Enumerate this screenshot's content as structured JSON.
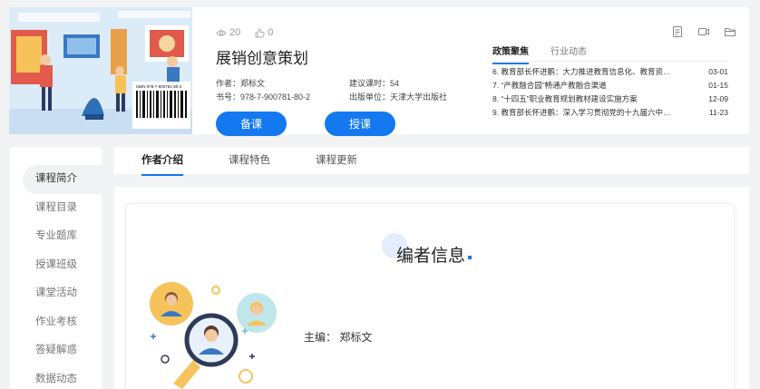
{
  "book": {
    "views": "20",
    "likes": "0",
    "title": "展销创意策划",
    "author": "作者：郑标文",
    "hours": "建议课时：54",
    "isbn": "书号：978-7-900781-80-2",
    "publisher": "出版单位：天津大学出版社",
    "btn_prepare": "备课",
    "btn_teach": "授课",
    "barcode_text": "ISBN 978-7-900781-80-2"
  },
  "news": {
    "tabs": [
      "政策聚焦",
      "行业动态"
    ],
    "items": [
      {
        "title": "6. 教育部长怀进鹏：大力推进教育信息化、教育资…",
        "date": "03-01"
      },
      {
        "title": "7. “产教融合园”畅通产教融合渠道",
        "date": "01-15"
      },
      {
        "title": "8. “十四五”职业教育规划教材建设实施方案",
        "date": "12-09"
      },
      {
        "title": "9. 教育部长怀进鹏：深入学习贯彻党的十九届六中…",
        "date": "11-23"
      }
    ]
  },
  "tools": [
    "notes-icon",
    "video-icon",
    "folder-icon"
  ],
  "sidebar": {
    "items": [
      "课程简介",
      "课程目录",
      "专业题库",
      "授课班级",
      "课堂活动",
      "作业考核",
      "答疑解惑",
      "数据动态"
    ]
  },
  "main": {
    "tabs": [
      "作者介绍",
      "课程特色",
      "课程更新"
    ],
    "section_title": "编者信息",
    "editor": "主编：  郑标文"
  },
  "colors": {
    "accent": "#1478f0",
    "background": "#f2f3f5"
  }
}
